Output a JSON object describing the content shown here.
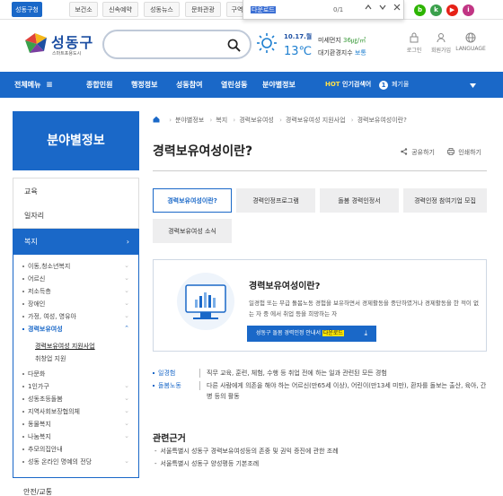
{
  "topbar": {
    "tabs": [
      "성동구청",
      "보건소",
      "신속예약",
      "성동뉴스",
      "문화관광",
      "구역"
    ]
  },
  "find": {
    "query": "다운로드",
    "count": "0/1",
    "prev": "^",
    "next": "v",
    "close": "✕"
  },
  "sns": [
    {
      "name": "blog",
      "letter": "b",
      "color": "#2db400"
    },
    {
      "name": "kakao",
      "letter": "k",
      "color": "#3aa04b"
    },
    {
      "name": "twitter",
      "letter": "t",
      "color": "#1da1f2"
    },
    {
      "name": "youtube",
      "letter": "▶",
      "color": "#e62117"
    },
    {
      "name": "instagram",
      "letter": "i",
      "color": "#c13584"
    }
  ],
  "header": {
    "logo": "성동구",
    "logo_sub": "스마트포용도시",
    "search_placeholder": "",
    "weather": {
      "date": "10.17.월",
      "temp": "13℃",
      "dust_label": "미세먼지",
      "dust_value": "36㎍/㎥",
      "air_label": "대기환경지수",
      "air_value": "보통"
    },
    "icons": [
      {
        "label": "로그인",
        "icon": "lock-icon"
      },
      {
        "label": "회원가입",
        "icon": "user-icon"
      },
      {
        "label": "LANGUAGE",
        "icon": "globe-icon"
      }
    ]
  },
  "nav": {
    "all_menu": "전체메뉴",
    "items": [
      "종합민원",
      "행정정보",
      "성동참여",
      "열린성동",
      "분야별정보"
    ],
    "hot_prefix": "HOT",
    "hot_label": "인기검색어",
    "hot_rank": "1",
    "hot_item": "폐기물"
  },
  "sidebar": {
    "title": "분야별정보",
    "top_items": [
      "교육",
      "일자리",
      "복지"
    ],
    "sub_items": [
      {
        "label": "이동,청소년복지",
        "chev": true
      },
      {
        "label": "어르신",
        "chev": true
      },
      {
        "label": "저소득층",
        "chev": true
      },
      {
        "label": "장애인",
        "chev": true
      },
      {
        "label": "가정, 여성, 영유아",
        "chev": true
      },
      {
        "label": "경력보유여성",
        "chev": true,
        "active": true
      }
    ],
    "sub2_items": [
      "경력보유여성 지원사업",
      "취창업 지원"
    ],
    "sub_items_after": [
      {
        "label": "다문화",
        "chev": false
      },
      {
        "label": "1인가구",
        "chev": true
      },
      {
        "label": "성동초등돌봄",
        "chev": true
      },
      {
        "label": "지역사회보장협의체",
        "chev": true
      },
      {
        "label": "동물복지",
        "chev": true
      },
      {
        "label": "나눔복지",
        "chev": true
      },
      {
        "label": "추모의집안내",
        "chev": false
      },
      {
        "label": "성동 온라인 명예의 전당",
        "chev": true
      }
    ],
    "next_item": "안전/교통"
  },
  "content": {
    "breadcrumb": [
      "분야별정보",
      "복지",
      "경력보유여성",
      "경력보유여성 지원사업",
      "경력보유여성이란?"
    ],
    "title": "경력보유여성이란?",
    "share": "공유하기",
    "print": "인쇄하기",
    "tabs": [
      "경력보유여성이란?",
      "경력인정프로그램",
      "돌봄 경력인정서",
      "경력인정 참여기업 모집",
      "경력보유여성 소식"
    ],
    "info": {
      "title": "경력보유여성이란?",
      "desc": "일경험 또는 무급 돌봄노동 경험을 보유하면서 경제활동을 중단하였거나 경제활동을 한 적이 없는 자 중 에서 취업 등을 희망하는 자",
      "button_prefix": "성동구 돌봄 경력인정 안내서 ",
      "button_highlight": "다운로드",
      "button_icon": "download-icon"
    },
    "definitions": [
      {
        "term": "일경험",
        "text": "직무 교육, 훈련, 체험, 수행 등 취업 전에 하는 일과 관련된 모든 경험"
      },
      {
        "term": "돌봄노동",
        "text": "다른 사람에게 의존을 해야 하는 어르신(만65세 이상), 어린이(만13세 미만), 환자를 돌보는 출산, 육아, 간병 등의 활동"
      }
    ],
    "basis_title": "관련근거",
    "basis_items": [
      "서울특별시 성동구 경력보유여성등의 존중 및 권익 증진에 관한 조례",
      "서울특별시 성동구 양성평등 기본조례"
    ]
  },
  "colors": {
    "primary": "#1a68c8",
    "highlight": "#ffe600"
  }
}
